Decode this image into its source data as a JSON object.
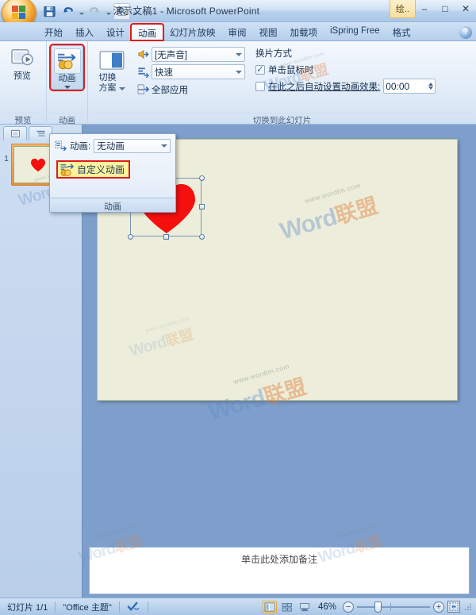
{
  "window": {
    "title": "演示文稿1 - Microsoft PowerPoint",
    "contextual_tab": "绘..",
    "minimize": "–",
    "maximize": "□",
    "close": "✕"
  },
  "quick_access": {
    "office_button": "office-orb",
    "items": [
      {
        "name": "save-icon",
        "tooltip": "保存"
      },
      {
        "name": "undo-icon",
        "tooltip": "撤消"
      },
      {
        "name": "redo-icon",
        "tooltip": "恢复"
      },
      {
        "name": "quick-print-icon",
        "tooltip": "打印预览"
      }
    ]
  },
  "tabs": [
    {
      "label": "开始",
      "active": false
    },
    {
      "label": "插入",
      "active": false
    },
    {
      "label": "设计",
      "active": false
    },
    {
      "label": "动画",
      "active": true,
      "highlighted": true
    },
    {
      "label": "幻灯片放映",
      "active": false
    },
    {
      "label": "审阅",
      "active": false
    },
    {
      "label": "视图",
      "active": false
    },
    {
      "label": "加载项",
      "active": false
    },
    {
      "label": "iSpring Free",
      "active": false
    },
    {
      "label": "格式",
      "active": false
    }
  ],
  "help_button": "?",
  "ribbon": {
    "groups": [
      {
        "label": "预览",
        "buttons": [
          {
            "label": "预览",
            "icon": "preview-icon",
            "state": "normal"
          }
        ]
      },
      {
        "label": "动画",
        "buttons": [
          {
            "label": "动画",
            "icon": "animation-icon",
            "state": "selected",
            "highlighted": true,
            "has_caret": true
          }
        ]
      },
      {
        "label": "切换到此幻灯片",
        "transition_scheme": {
          "line1": "切换",
          "line2": "方案"
        },
        "sound_label": "transition-sound-icon",
        "sound_value": "[无声音]",
        "speed_label": "transition-speed-icon",
        "speed_value": "快速",
        "apply_all": "全部应用",
        "advance_title": "换片方式",
        "on_click": {
          "label": "单击鼠标时",
          "checked": true
        },
        "auto_after": {
          "label": "在此之后自动设置动画效果:",
          "checked": false,
          "value": "00:00"
        }
      }
    ]
  },
  "animation_popup": {
    "dropdown_label": "动画:",
    "dropdown_value": "无动画",
    "custom_animation": "自定义动画",
    "footer_label": "动画"
  },
  "slides_pane": {
    "tabs": [
      "幻灯片",
      "大纲"
    ],
    "thumbnails": [
      {
        "number": "1",
        "selected": true,
        "content": "heart-shape"
      }
    ]
  },
  "slide": {
    "shape": "heart-shape",
    "selected": true,
    "handles": 8,
    "rotation_handle": true
  },
  "notes": {
    "placeholder": "单击此处添加备注"
  },
  "status_bar": {
    "slide_counter": "幻灯片 1/1",
    "theme": "\"Office 主题\"",
    "spellcheck_icon": "spellcheck-icon",
    "view_buttons": [
      {
        "name": "normal-view-button",
        "active": true
      },
      {
        "name": "slide-sorter-view-button",
        "active": false
      },
      {
        "name": "slide-show-view-button",
        "active": false
      }
    ],
    "zoom_level": "46%",
    "zoom_out": "−",
    "zoom_in": "+",
    "fit_button": "fit-slide-to-window-icon"
  },
  "watermarks": {
    "word": "Word",
    "union": "联盟",
    "url": "www.wordlm.com"
  },
  "colors": {
    "accent_red": "#e01b1b",
    "highlight_yellow": "#fdf39c",
    "heart_red": "#f50f0f",
    "slide_bg": "#eceedb",
    "window_blue": "#7e9fcb"
  }
}
